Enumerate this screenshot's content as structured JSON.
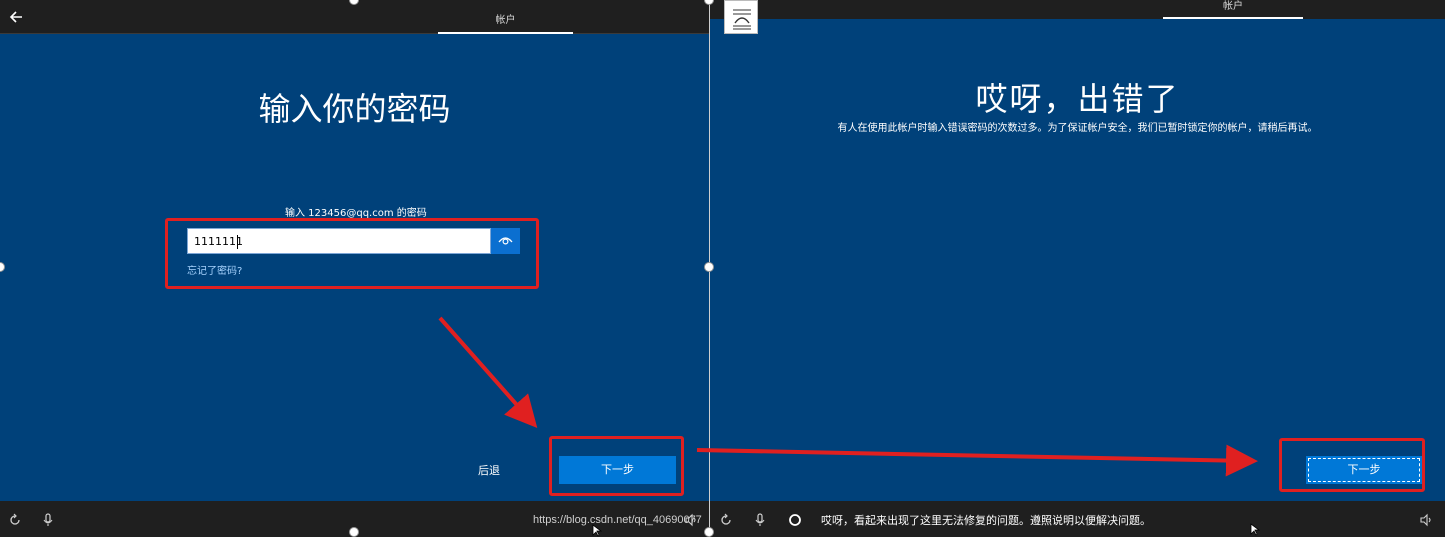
{
  "left_panel": {
    "header_tab": "帐户",
    "title": "输入你的密码",
    "prompt": "输入 123456@qq.com 的密码",
    "password_value": "1111111",
    "forgot_link": "忘记了密码?",
    "back_label": "后退",
    "next_label": "下一步",
    "watermark": "https://blog.csdn.net/qq_40690077"
  },
  "right_panel": {
    "header_tab": "帐户",
    "title": "哎呀，出错了",
    "message": "有人在使用此帐户时输入错误密码的次数过多。为了保证帐户安全，我们已暂时锁定你的帐户，请稍后再试。",
    "next_label": "下一步",
    "status_text": "哎呀，看起来出现了这里无法修复的问题。遵照说明以便解决问题。"
  },
  "icons": [
    "back-arrow-icon",
    "eye-icon",
    "ease-of-access-icon",
    "microphone-icon",
    "volume-icon",
    "cortana-circle-icon",
    "document-icon"
  ],
  "colors": {
    "oobe_blue": "#00417a",
    "button_blue": "#0078d7",
    "annotation_red": "#e02020",
    "bar_dark": "#1f1f1f"
  }
}
